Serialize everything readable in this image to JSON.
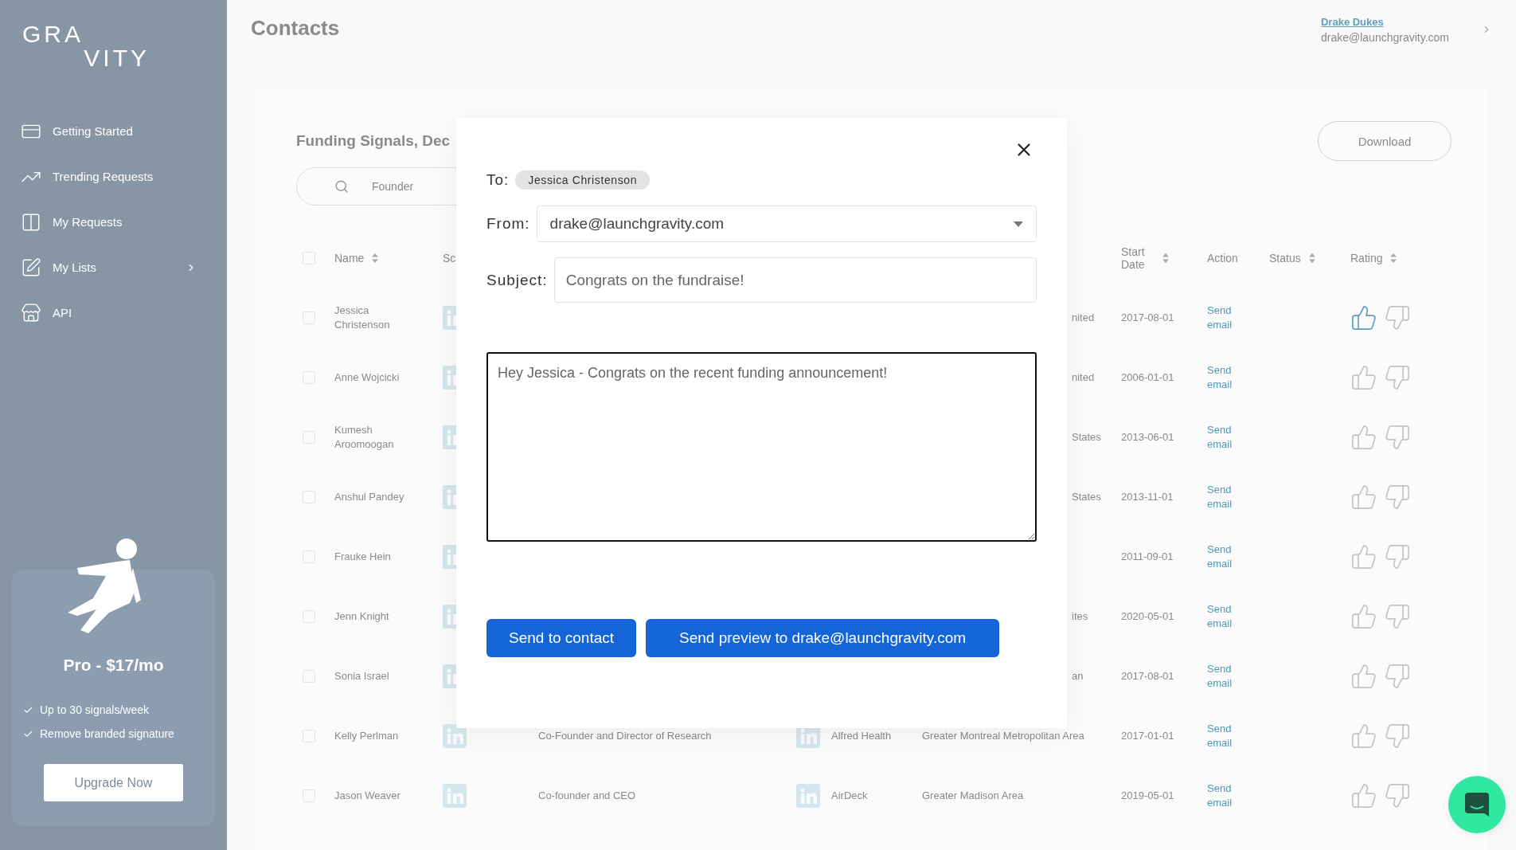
{
  "sidebar": {
    "logo": [
      "GRA",
      "VITY"
    ],
    "nav_items": [
      {
        "label": "Getting Started",
        "has_submenu": false
      },
      {
        "label": "Trending Requests",
        "has_submenu": false
      },
      {
        "label": "My Requests",
        "has_submenu": false
      },
      {
        "label": "My Lists",
        "has_submenu": true
      },
      {
        "label": "API",
        "has_submenu": false
      }
    ],
    "plan_card": {
      "title": "Pro - $17/mo",
      "features": [
        "Up to 30 signals/week",
        "Remove branded signature"
      ],
      "button": "Upgrade Now"
    }
  },
  "header": {
    "title": "Contacts",
    "user": {
      "name": "Drake Dukes",
      "email": "drake@launchgravity.com"
    }
  },
  "panel": {
    "title": "Funding Signals, Dec",
    "download_button": "Download",
    "search": {
      "placeholder": "Founder"
    },
    "table": {
      "select_all_checked": false,
      "columns": [
        {
          "label": "Name",
          "sortable": true
        },
        {
          "label": "Sc",
          "sortable": false
        },
        {
          "label": "Start Date",
          "sortable": true
        },
        {
          "label": "Action",
          "sortable": false
        },
        {
          "label": "Status",
          "sortable": true
        },
        {
          "label": "Rating",
          "sortable": true
        }
      ],
      "rows": [
        {
          "checked": false,
          "name": "Jessica Christenson",
          "location": "nited",
          "start_date": "2017-08-01",
          "action": "Send email",
          "liked": true
        },
        {
          "checked": false,
          "name": "Anne Wojcicki",
          "location": "nited",
          "start_date": "2006-01-01",
          "action": "Send email",
          "liked": false
        },
        {
          "checked": false,
          "name": "Kumesh Aroomoogan",
          "location": "States",
          "start_date": "2013-06-01",
          "action": "Send email",
          "liked": false
        },
        {
          "checked": false,
          "name": "Anshul Pandey",
          "location": "States",
          "start_date": "2013-11-01",
          "action": "Send email",
          "liked": false
        },
        {
          "checked": false,
          "name": "Frauke Hein",
          "start_date": "2011-09-01",
          "action": "Send email",
          "liked": false
        },
        {
          "checked": false,
          "name": "Jenn Knight",
          "location": "ites",
          "start_date": "2020-05-01",
          "action": "Send email",
          "liked": false
        },
        {
          "checked": false,
          "name": "Sonia Israel",
          "location": "an",
          "start_date": "2017-08-01",
          "action": "Send email",
          "liked": false
        },
        {
          "checked": false,
          "name": "Kelly Perlman",
          "title": "Co-Founder and Director of Research",
          "company": "Alfred Health",
          "location": "Greater Montreal Metropolitan Area",
          "start_date": "2017-01-01",
          "action": "Send email",
          "liked": false
        },
        {
          "checked": false,
          "name": "Jason Weaver",
          "title": "Co-founder and CEO",
          "company": "AirDeck",
          "location": "Greater Madison Area",
          "start_date": "2019-05-01",
          "action": "Send email",
          "liked": false
        }
      ]
    }
  },
  "email_dialog": {
    "to_label": "To:",
    "recipient": "Jessica Christenson",
    "from_label": "From:",
    "from_value": "drake@launchgravity.com",
    "subject_label": "Subject:",
    "subject_value": "Congrats on the fundraise!",
    "message": "Hey Jessica - Congrats on the recent funding announcement!",
    "buttons": [
      "Send to contact",
      "Send preview to drake@launchgravity.com"
    ]
  }
}
